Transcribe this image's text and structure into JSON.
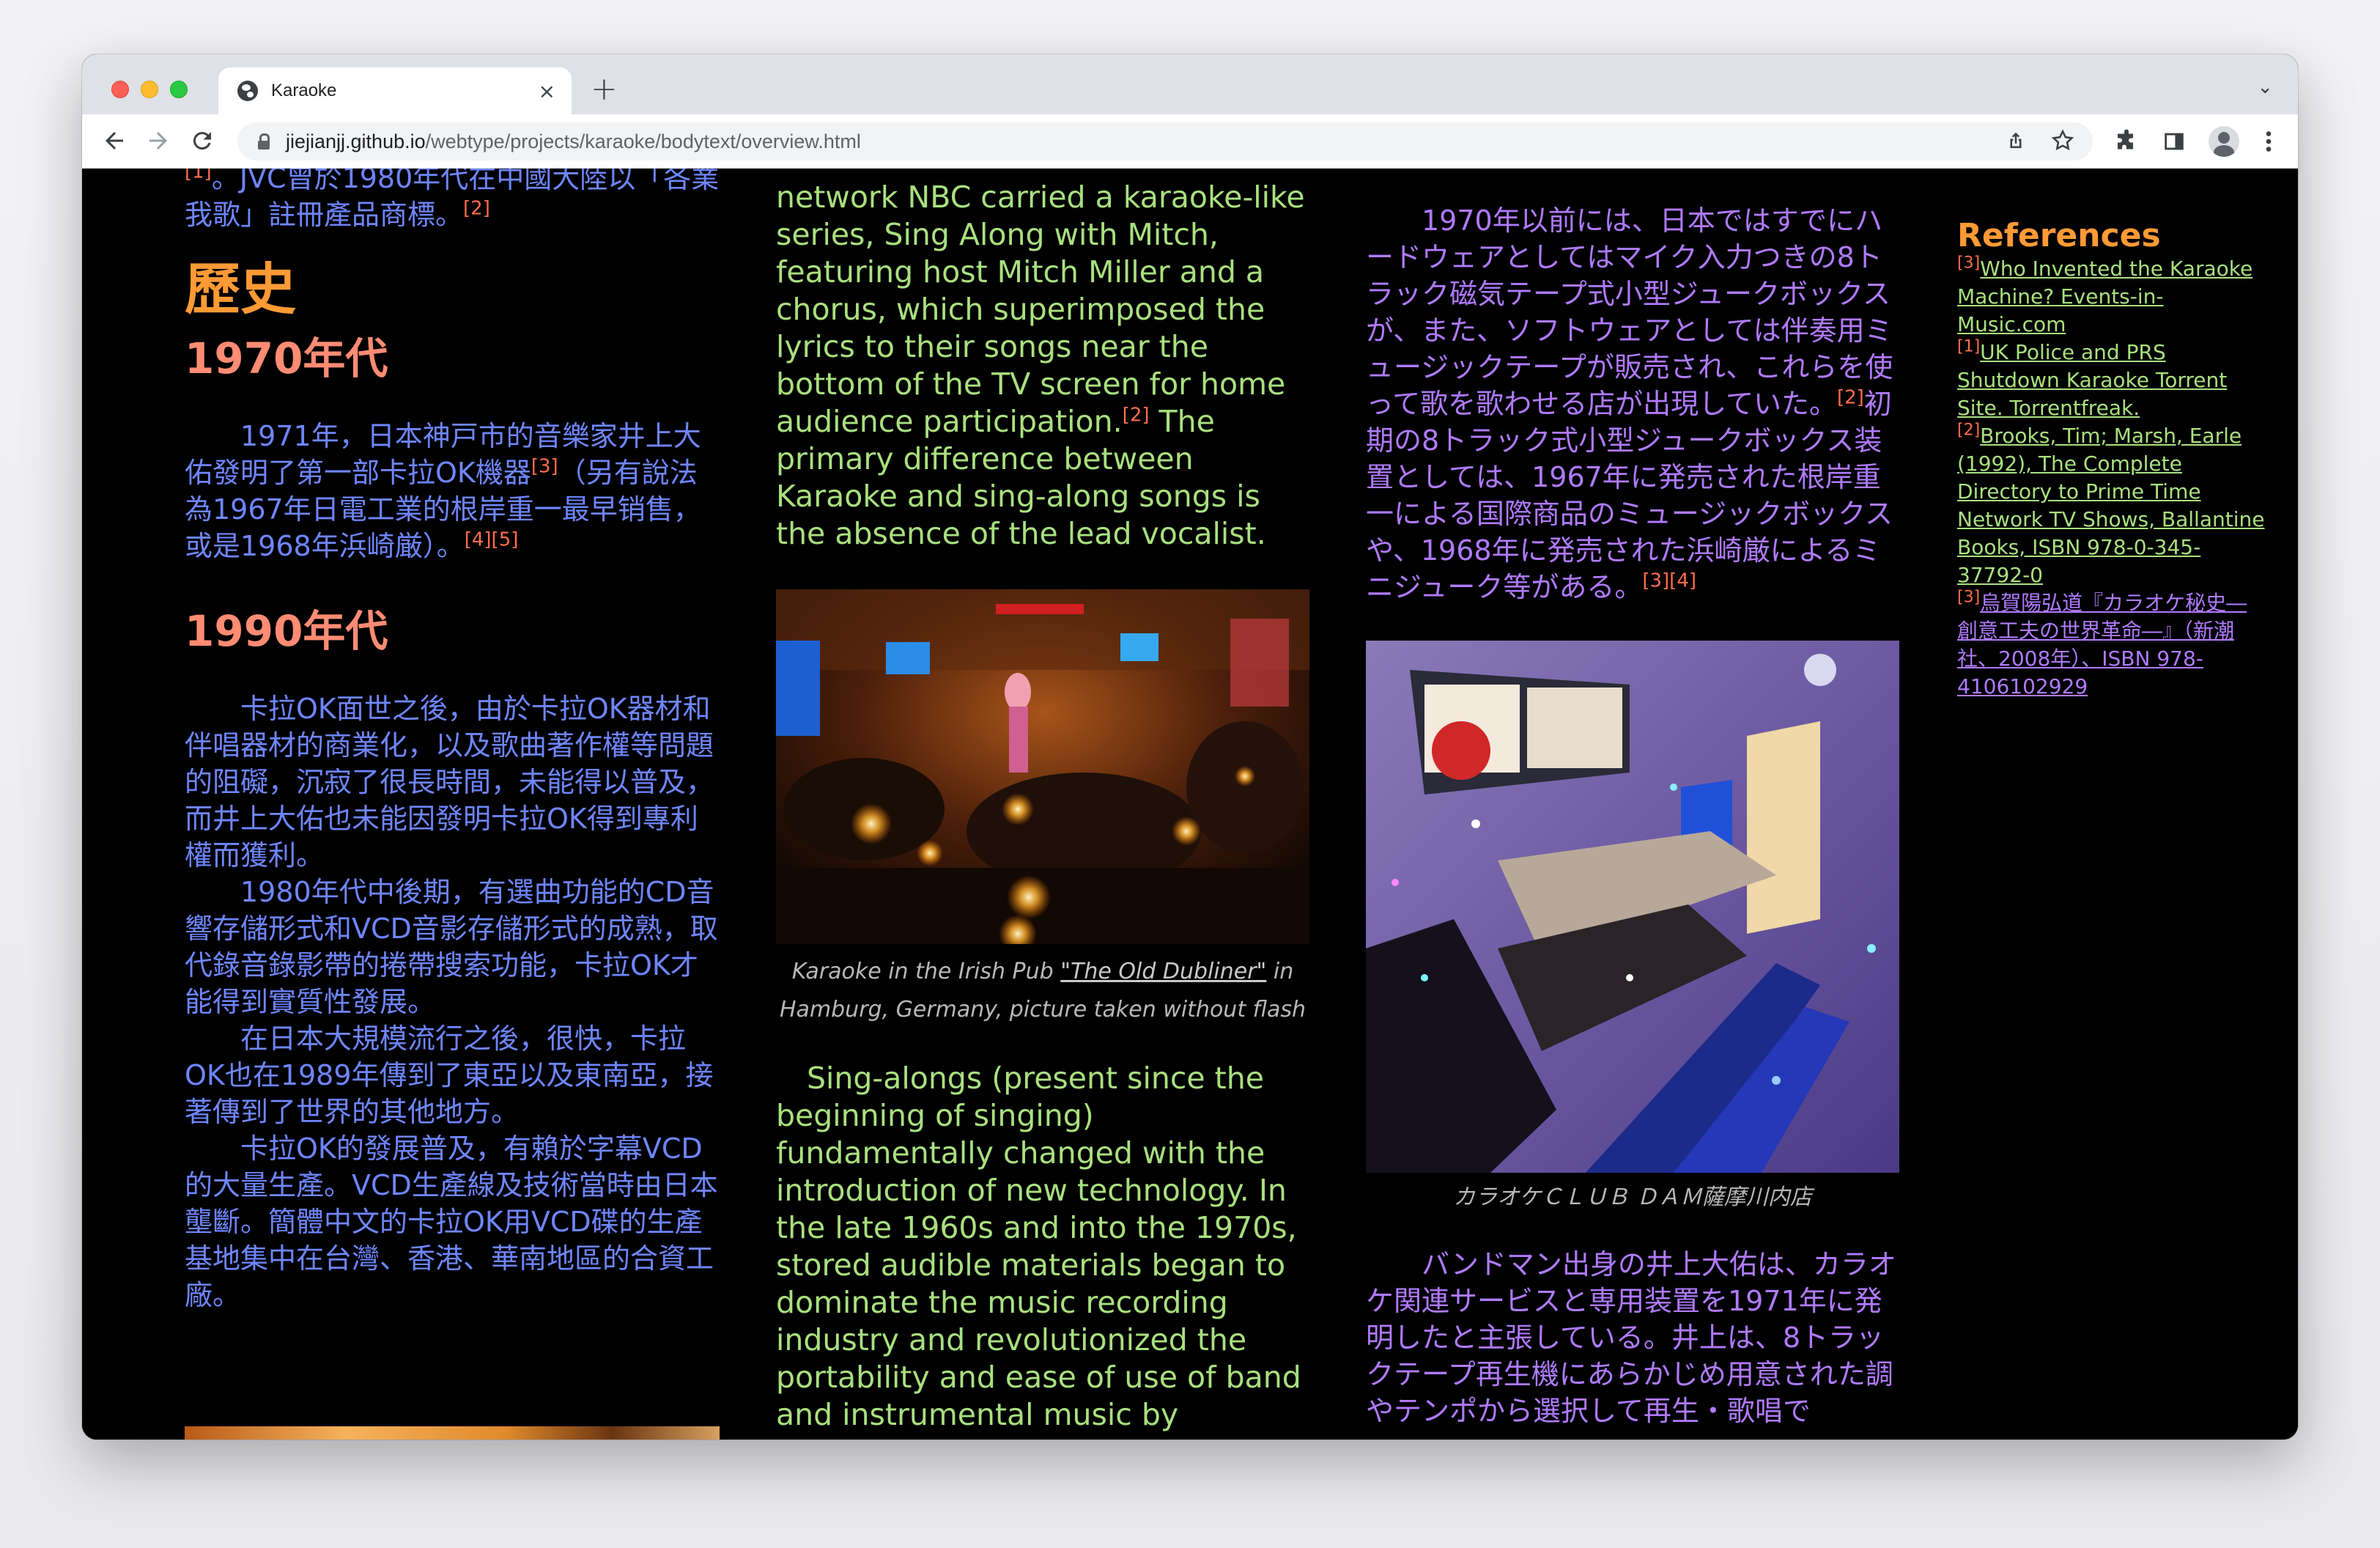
{
  "browser": {
    "tab_title": "Karaoke",
    "tab_close": "×",
    "new_tab": "+",
    "tab_menu": "⌄",
    "url_host": "jiejianjj.github.io",
    "url_path": "/webtype/projects/karaoke/bodytext/overview.html"
  },
  "col1": {
    "top_line1": "。JVC曾於1980年代在中國大陸以「各業",
    "top_line2": "我歌」註冊產品商標。",
    "ref_top_a": "[1]",
    "ref_top": "[2]",
    "history_heading": "歷史",
    "h_1970s": "1970年代",
    "p1": "1971年，日本神戸市的音樂家井上大佑發明了第一部卡拉OK機器",
    "p1_ref1": "[3]",
    "p1_b": "（另有說法為1967年日電工業的根岸重一最早销售，或是1968年浜崎厳）。",
    "p1_ref2": "[4][5]",
    "h_1990s": "1990年代",
    "p2": "卡拉OK面世之後，由於卡拉OK器材和伴唱器材的商業化，以及歌曲著作權等問題的阻礙，沉寂了很長時間，未能得以普及，而井上大佑也未能因發明卡拉OK得到專利權而獲利。",
    "p3": "1980年代中後期，有選曲功能的CD音響存儲形式和VCD音影存儲形式的成熟，取代錄音錄影帶的捲帶搜索功能，卡拉OK才能得到實質性發展。",
    "p4": "在日本大規模流行之後，很快，卡拉OK也在1989年傳到了東亞以及東南亞，接著傳到了世界的其他地方。",
    "p5": "卡拉OK的發展普及，有賴於字幕VCD的大量生產。VCD生產線及技術當時由日本壟斷。簡體中文的卡拉OK用VCD碟的生產基地集中在台灣、香港、華南地區的合資工廠。"
  },
  "col2": {
    "p1": "network NBC carried a karaoke-like series, Sing Along with Mitch, featuring host Mitch Miller and a chorus, which superimposed the lyrics to their songs near the bottom of the TV screen for home audience participation.",
    "p1_ref": "[2]",
    "p1_b": " The primary difference between Karaoke and sing-along songs is the absence of the lead vocalist.",
    "caption_a": "Karaoke in the Irish Pub ",
    "caption_link": "\"The Old Dubliner\"",
    "caption_b": " in Hamburg, Germany, picture taken without flash",
    "p2": "Sing-alongs (present since the beginning of singing) fundamentally changed with the introduction of new technology. In the late 1960s and into the 1970s, stored audible materials began to dominate the music recording industry and revolutionized the portability and ease of use of band and instrumental music by musicians and entertainers as the"
  },
  "col3": {
    "p1": "1970年以前には、日本ではすでにハードウェアとしてはマイク入力つきの8トラック磁気テープ式小型ジュークボックスが、また、ソフトウェアとしては伴奏用ミュージックテープが販売され、これらを使って歌を歌わせる店が出現していた。",
    "p1_ref": "[2]",
    "p1_b": "初期の8トラック式小型ジュークボックス装置としては、1967年に発売された根岸重一による国際商品のミュージックボックスや、1968年に発売された浜崎厳によるミニジューク等がある。",
    "p1_ref2": "[3][4]",
    "caption": "カラオケＣＬＵＢ ＤＡＭ薩摩川内店",
    "p2": "バンドマン出身の井上大佑は、カラオケ関連サービスと専用装置を1971年に発明したと主張している。井上は、8トラックテープ再生機にあらかじめ用意された調やテンポから選択して再生・歌唱で"
  },
  "col4": {
    "heading": "References",
    "refs": [
      {
        "num": "[3]",
        "text": "Who Invented the Karaoke Machine? Events-in-Music.com"
      },
      {
        "num": "[1]",
        "text": "UK Police and PRS Shutdown Karaoke Torrent Site. Torrentfreak."
      },
      {
        "num": "[2]",
        "text": "Brooks, Tim; Marsh, Earle (1992), The Complete Directory to Prime Time Network TV Shows, Ballantine Books, ISBN 978-0-345-37792-0"
      },
      {
        "num": "[3]",
        "text": "烏賀陽弘道『カラオケ秘史―創意工夫の世界革命―』（新潮社、2008年）、ISBN 978-4106102929"
      }
    ]
  }
}
